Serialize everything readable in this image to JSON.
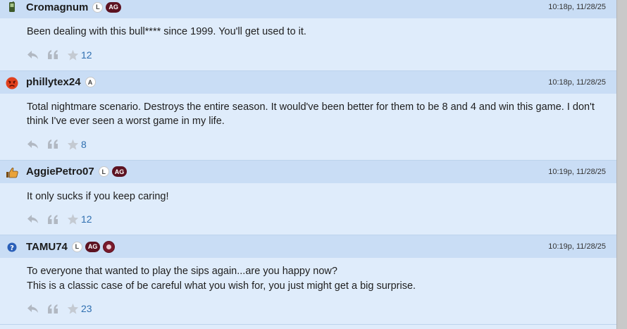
{
  "posts": [
    {
      "username": "Cromagnum",
      "avatar_icon": "phone-icon",
      "badges": [
        "L",
        "AG"
      ],
      "timestamp": "10:18p, 11/28/25",
      "lines": [
        "Been dealing with this bull**** since 1999. You'll get used to it."
      ],
      "likes": "12"
    },
    {
      "username": "phillytex24",
      "avatar_icon": "angry-face-icon",
      "badges": [
        "A"
      ],
      "timestamp": "10:18p, 11/28/25",
      "lines": [
        "Total nightmare scenario. Destroys the entire season. It would've been better for them to be 8 and 4 and win this game. I don't think I've ever seen a worst game in my life."
      ],
      "likes": "8"
    },
    {
      "username": "AggiePetro07",
      "avatar_icon": "thumbs-up-icon",
      "badges": [
        "L",
        "AG"
      ],
      "timestamp": "10:19p, 11/28/25",
      "lines": [
        "It only sucks if you keep caring!"
      ],
      "likes": "12"
    },
    {
      "username": "TAMU74",
      "avatar_icon": "question-icon",
      "badges": [
        "L",
        "AG",
        "emblem"
      ],
      "timestamp": "10:19p, 11/28/25",
      "lines": [
        "To everyone that wanted to play the sips again...are you happy now?",
        "This is a classic case of be careful what you wish for, you just might get a big surprise."
      ],
      "likes": "23"
    }
  ]
}
